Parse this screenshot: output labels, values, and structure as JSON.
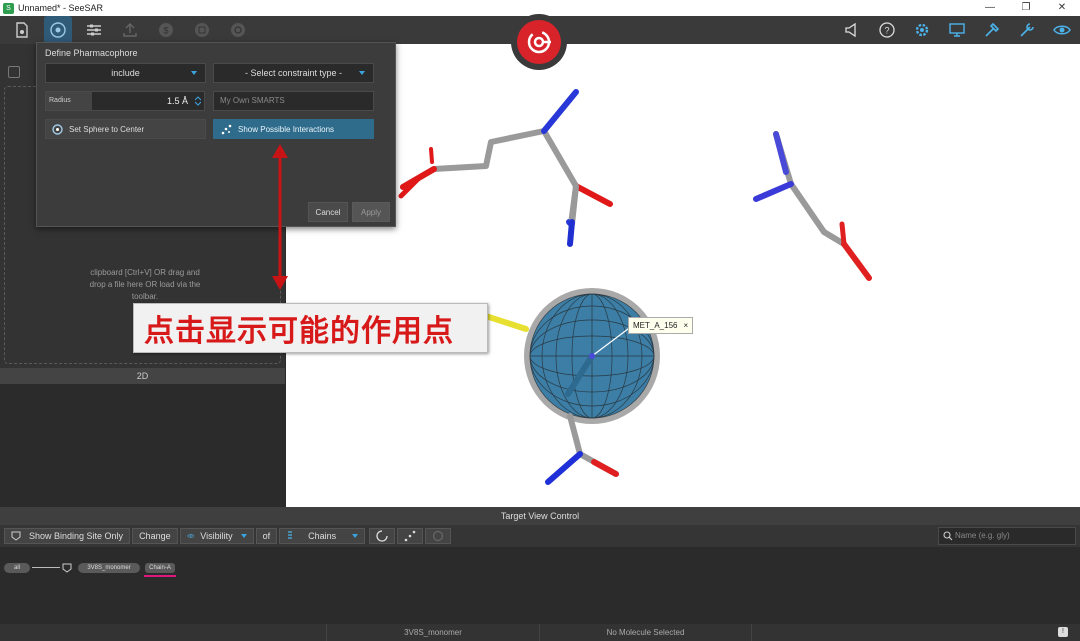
{
  "window": {
    "title": "Unnamed* - SeeSAR",
    "app_icon": "seesar-icon"
  },
  "toolbar": {
    "left_icons": [
      "file-icon",
      "pharmacophore-icon",
      "sliders-icon",
      "upload-icon",
      "filter-icon",
      "table-icon",
      "settings-cog-icon"
    ],
    "right_icons": [
      "megaphone-icon",
      "help-icon",
      "gear-icon",
      "monitor-icon",
      "tools-icon",
      "wrench-icon",
      "eye-icon"
    ]
  },
  "dialog": {
    "title": "Define Pharmacophore",
    "include_select": "include",
    "constraint_select": "- Select constraint type -",
    "radius_label": "Radius",
    "radius_value": "1.5 Å",
    "smarts_placeholder": "My Own SMARTS",
    "set_sphere_label": "Set Sphere to Center",
    "show_interactions_label": "Show Possible Interactions",
    "cancel_label": "Cancel",
    "apply_label": "Apply"
  },
  "left_panel": {
    "drop_text": "clipboard [Ctrl+V] OR drag and drop a file here OR load via the toolbar.",
    "label_2d": "2D"
  },
  "view3d": {
    "tooltip_label": "MET_A_156",
    "tooltip_close": "×"
  },
  "annotation": {
    "text": "点击显示可能的作用点"
  },
  "target_view": {
    "header": "Target View Control",
    "show_binding_label": "Show Binding Site Only",
    "change_label": "Change",
    "visibility_label": "Visibility",
    "of_label": "of",
    "chains_label": "Chains",
    "name_placeholder": "Name (e.g. gly)",
    "tree": {
      "all": "all",
      "monomer": "3V8S_monomer",
      "chain": "Chain-A"
    }
  },
  "statusbar": {
    "left": "3V8S_monomer",
    "right": "No Molecule Selected"
  },
  "colors": {
    "accent": "#2f6b8a",
    "brand_red": "#d9232a",
    "annotation_red": "#d81919"
  }
}
